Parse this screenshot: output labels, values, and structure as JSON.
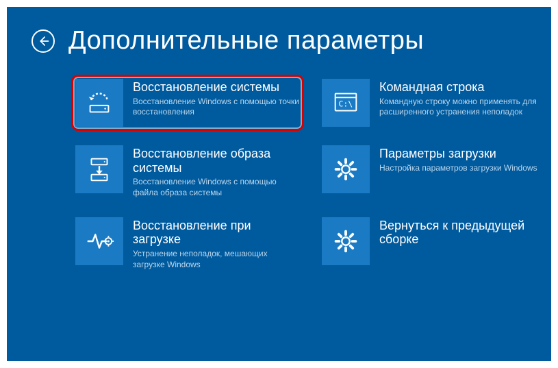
{
  "page": {
    "title": "Дополнительные параметры"
  },
  "tiles": [
    {
      "title": "Восстановление системы",
      "desc": "Восстановление Windows с помощью точки восстановления",
      "icon": "restore-point"
    },
    {
      "title": "Командная строка",
      "desc": "Командную строку можно применять для расширенного устранения неполадок",
      "icon": "cmd"
    },
    {
      "title": "Восстановление образа системы",
      "desc": "Восстановление Windows с помощью файла образа системы",
      "icon": "image-restore"
    },
    {
      "title": "Параметры загрузки",
      "desc": "Настройка параметров загрузки Windows",
      "icon": "gear"
    },
    {
      "title": "Восстановление при загрузке",
      "desc": "Устранение неполадок, мешающих загрузке Windows",
      "icon": "startup-repair"
    },
    {
      "title": "Вернуться к предыдущей сборке",
      "desc": "",
      "icon": "gear"
    }
  ],
  "highlighted_index": 0
}
